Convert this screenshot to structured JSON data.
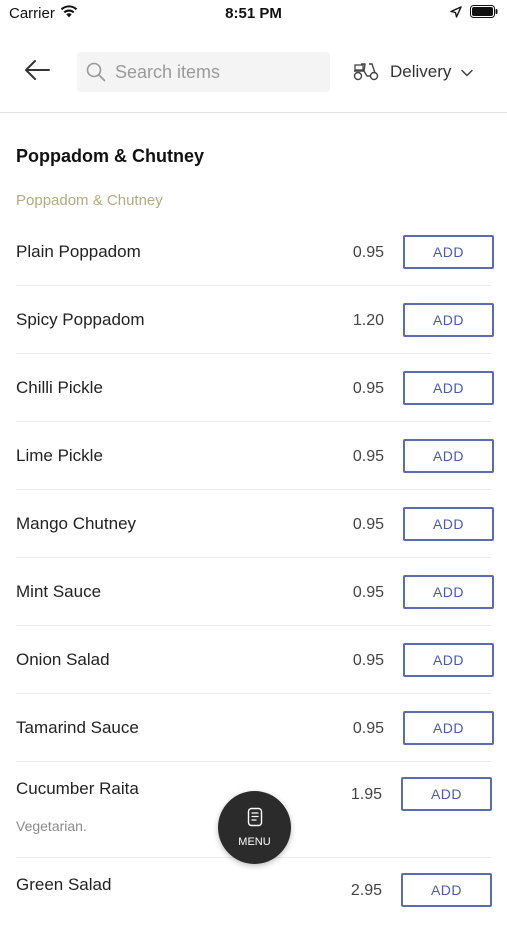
{
  "status_bar": {
    "carrier": "Carrier",
    "time": "8:51 PM"
  },
  "header": {
    "back_icon": "arrow-left-icon",
    "search_placeholder": "Search items",
    "delivery_label": "Delivery"
  },
  "section": {
    "title": "Poppadom & Chutney",
    "subsection": "Poppadom & Chutney"
  },
  "items": [
    {
      "name": "Plain Poppadom",
      "price": "0.95",
      "add_label": "ADD"
    },
    {
      "name": "Spicy Poppadom",
      "price": "1.20",
      "add_label": "ADD"
    },
    {
      "name": "Chilli Pickle",
      "price": "0.95",
      "add_label": "ADD"
    },
    {
      "name": "Lime Pickle",
      "price": "0.95",
      "add_label": "ADD"
    },
    {
      "name": "Mango Chutney",
      "price": "0.95",
      "add_label": "ADD"
    },
    {
      "name": "Mint Sauce",
      "price": "0.95",
      "add_label": "ADD"
    },
    {
      "name": "Onion Salad",
      "price": "0.95",
      "add_label": "ADD"
    },
    {
      "name": "Tamarind Sauce",
      "price": "0.95",
      "add_label": "ADD"
    },
    {
      "name": "Cucumber Raita",
      "price": "1.95",
      "add_label": "ADD",
      "description": "Vegetarian."
    },
    {
      "name": "Green Salad",
      "price": "2.95",
      "add_label": "ADD"
    }
  ],
  "menu_button": {
    "label": "MENU"
  },
  "colors": {
    "accent": "#4a5aa8",
    "subsection": "#b3ab7f",
    "fab": "#2b2b2b"
  }
}
